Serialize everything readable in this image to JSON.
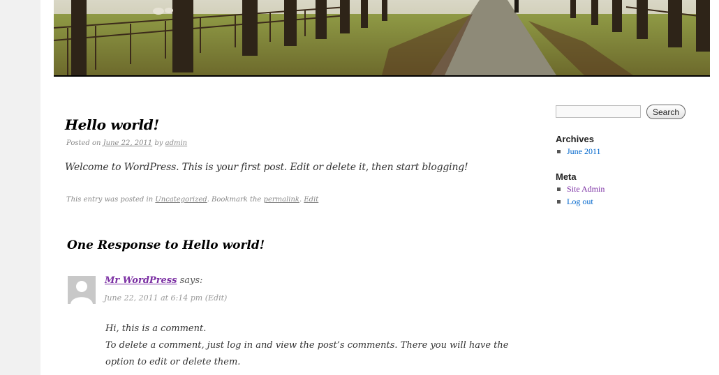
{
  "post": {
    "title": "Hello world!",
    "posted_on_prefix": "Posted on",
    "date": "June 22, 2011",
    "by_text": "by",
    "author": "admin",
    "content": "Welcome to WordPress. This is your first post. Edit or delete it, then start blogging!",
    "utility_prefix": "This entry was posted in",
    "category": "Uncategorized",
    "bookmark_text": ". Bookmark the",
    "permalink": "permalink",
    "separator": ".",
    "edit": "Edit"
  },
  "comments": {
    "title": "One Response to Hello world!",
    "items": [
      {
        "author": "Mr WordPress",
        "says": "says:",
        "datetime": "June 22, 2011 at 6:14 pm",
        "edit_open": "(",
        "edit": "Edit",
        "edit_close": ")",
        "line1": "Hi, this is a comment.",
        "line2": "To delete a comment, just log in and view the post’s comments. There you will have the option to edit or delete them."
      }
    ]
  },
  "sidebar": {
    "search_button": "Search",
    "search_value": "",
    "archives_title": "Archives",
    "archives": [
      "June 2011"
    ],
    "meta_title": "Meta",
    "meta": [
      "Site Admin",
      "Log out"
    ]
  },
  "colors": {
    "visited_link": "#7b2fa3",
    "link": "#0066cc"
  }
}
